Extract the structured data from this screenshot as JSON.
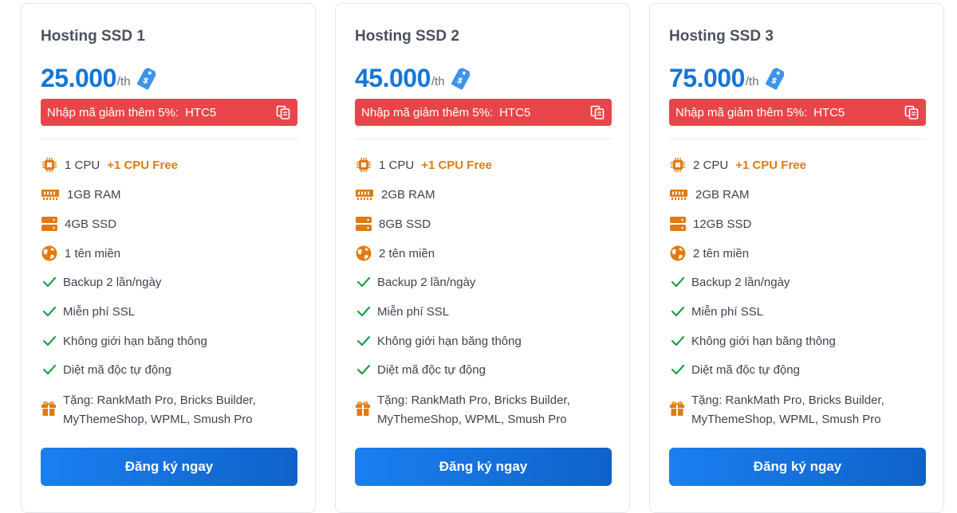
{
  "colors": {
    "price": "#1476d6",
    "promo_bg": "#e8454a",
    "bonus": "#e07b12",
    "check": "#1f9d4c",
    "cta": "#1a7ff0"
  },
  "plans": [
    {
      "title": "Hosting SSD 1",
      "price": "25.000",
      "unit": "/th",
      "promo_text": "Nhập mã giảm thêm 5%:",
      "promo_code": "HTC5",
      "cpu": "1 CPU",
      "cpu_bonus": "+1 CPU Free",
      "ram": "1GB RAM",
      "ssd": "4GB SSD",
      "domains": "1 tên miền",
      "checks": [
        "Backup 2 lần/ngày",
        "Miễn phí SSL",
        "Không giới hạn băng thông",
        "Diệt mã độc tự động"
      ],
      "gift": "Tặng: RankMath Pro, Bricks Builder, MyThemeShop, WPML, Smush Pro",
      "cta": "Đăng ký ngay"
    },
    {
      "title": "Hosting SSD 2",
      "price": "45.000",
      "unit": "/th",
      "promo_text": "Nhập mã giảm thêm 5%:",
      "promo_code": "HTC5",
      "cpu": "1 CPU",
      "cpu_bonus": "+1 CPU Free",
      "ram": "2GB RAM",
      "ssd": "8GB SSD",
      "domains": "2 tên miền",
      "checks": [
        "Backup 2 lần/ngày",
        "Miễn phí SSL",
        "Không giới hạn băng thông",
        "Diệt mã độc tự động"
      ],
      "gift": "Tặng: RankMath Pro, Bricks Builder, MyThemeShop, WPML, Smush Pro",
      "cta": "Đăng ký ngay"
    },
    {
      "title": "Hosting SSD 3",
      "price": "75.000",
      "unit": "/th",
      "promo_text": "Nhập mã giảm thêm 5%:",
      "promo_code": "HTC5",
      "cpu": "2 CPU",
      "cpu_bonus": "+1 CPU Free",
      "ram": "2GB RAM",
      "ssd": "12GB SSD",
      "domains": "2 tên miền",
      "checks": [
        "Backup 2 lần/ngày",
        "Miễn phí SSL",
        "Không giới hạn băng thông",
        "Diệt mã độc tự động"
      ],
      "gift": "Tặng: RankMath Pro, Bricks Builder, MyThemeShop, WPML, Smush Pro",
      "cta": "Đăng ký ngay"
    }
  ]
}
